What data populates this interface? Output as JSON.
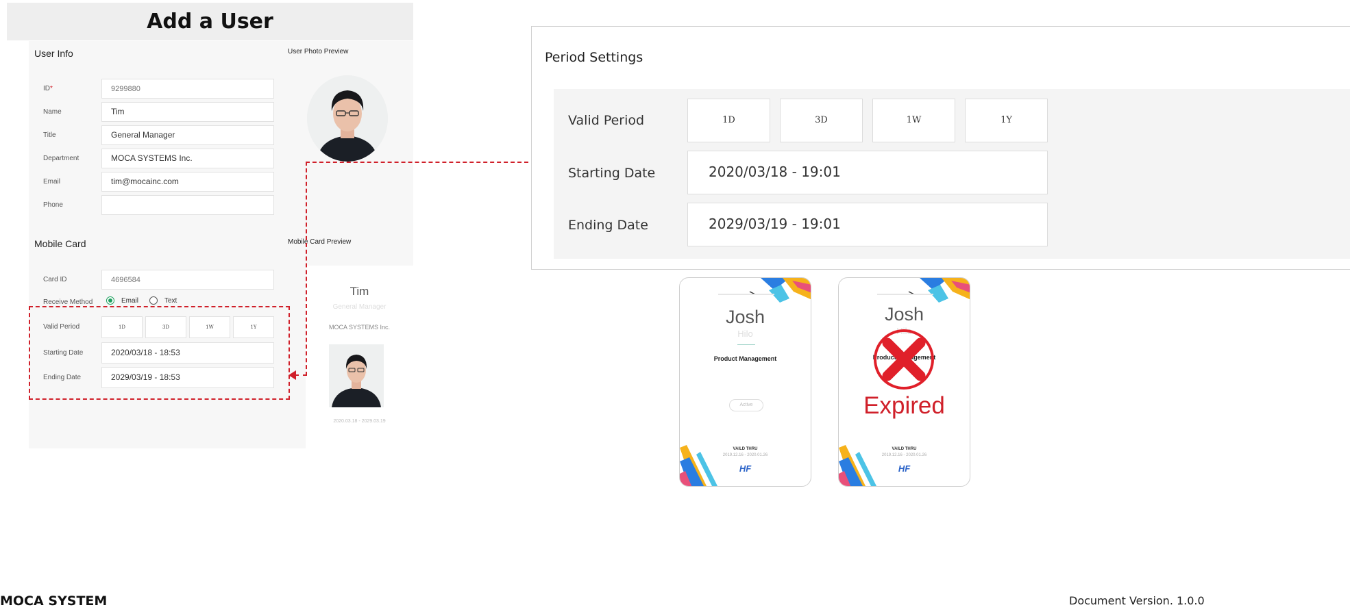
{
  "page_title": "Add a User",
  "user_info": {
    "heading": "User Info",
    "photo_preview_label": "User Photo Preview",
    "fields": {
      "id": {
        "label": "ID",
        "required_mark": "*",
        "placeholder": "9299880"
      },
      "name": {
        "label": "Name",
        "value": "Tim"
      },
      "title": {
        "label": "Title",
        "value": "General Manager"
      },
      "department": {
        "label": "Department",
        "value": "MOCA SYSTEMS Inc."
      },
      "email": {
        "label": "Email",
        "value": "tim@mocainc.com"
      },
      "phone": {
        "label": "Phone",
        "value": ""
      }
    }
  },
  "mobile_card": {
    "heading": "Mobile Card",
    "preview_label": "Mobile Card Preview",
    "card_id": {
      "label": "Card ID",
      "placeholder": "4696584"
    },
    "receive_method": {
      "label": "Receive Method",
      "options": [
        "Email",
        "Text"
      ],
      "selected": "Email"
    },
    "valid_period": {
      "label": "Valid Period",
      "options": [
        "1D",
        "3D",
        "1W",
        "1Y"
      ]
    },
    "starting_date": {
      "label": "Starting Date",
      "value": "2020/03/18 - 18:53"
    },
    "ending_date": {
      "label": "Ending Date",
      "value": "2029/03/19 - 18:53"
    }
  },
  "card_preview": {
    "name": "Tim",
    "title": "General Manager",
    "company": "MOCA SYSTEMS Inc.",
    "valid_range": "2020.03.18 - 2029.03.19"
  },
  "period_settings": {
    "heading": "Period Settings",
    "valid_period": {
      "label": "Valid Period",
      "options": [
        "1D",
        "3D",
        "1W",
        "1Y"
      ]
    },
    "starting_date": {
      "label": "Starting Date",
      "value": "2020/03/18 - 19:01"
    },
    "ending_date": {
      "label": "Ending Date",
      "value": "2029/03/19 - 19:01"
    }
  },
  "sample_cards": [
    {
      "name": "Josh",
      "sub": "Hilo",
      "department": "Product Management",
      "badge": "Active",
      "valid_label": "VAILD THRU",
      "dates": "2019.12.16 - 2020.01.26",
      "logo": "HF"
    },
    {
      "name": "Josh",
      "sub": "Hilo",
      "department": "Product Management",
      "valid_label": "VAILD THRU",
      "dates": "2019.12.16 - 2020.01.26",
      "logo": "HF",
      "status": "Expired"
    }
  ],
  "footer": {
    "left": "MOCA SYSTEM",
    "right": "Document Version. 1.0.0"
  },
  "colors": {
    "accent_red": "#d0202a",
    "radio_green": "#20a060",
    "logo_blue": "#2b63c8"
  }
}
